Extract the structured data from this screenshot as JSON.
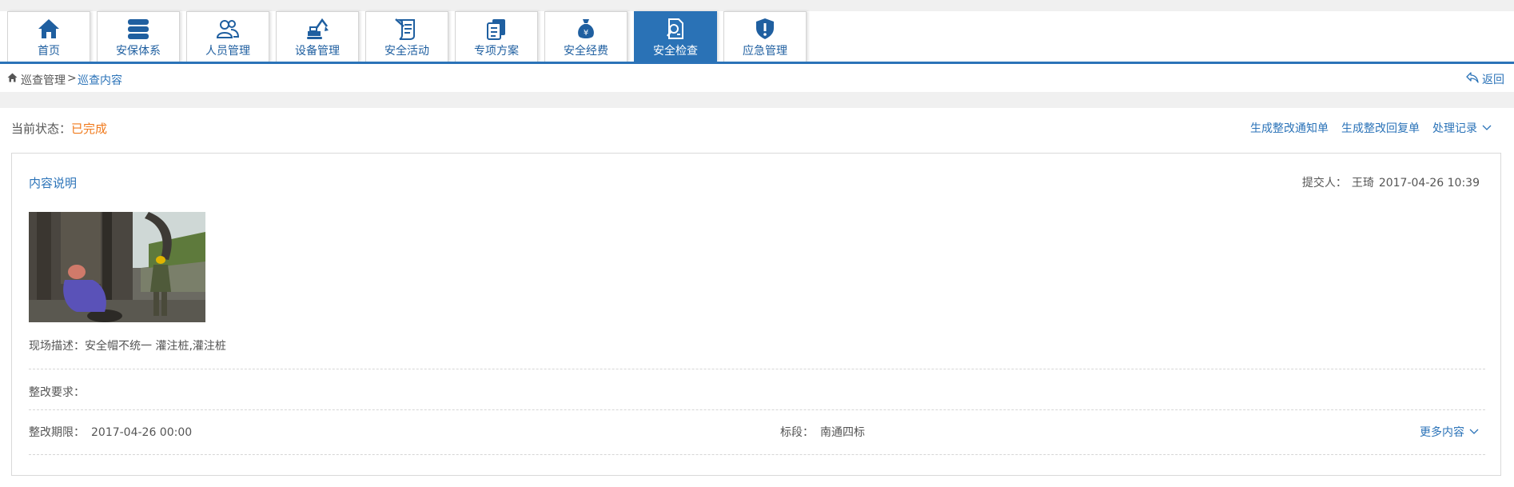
{
  "nav": {
    "tabs": [
      {
        "label": "首页",
        "icon": "home-icon"
      },
      {
        "label": "安保体系",
        "icon": "database-stack-icon"
      },
      {
        "label": "人员管理",
        "icon": "users-icon"
      },
      {
        "label": "设备管理",
        "icon": "excavator-icon"
      },
      {
        "label": "安全活动",
        "icon": "scroll-document-icon"
      },
      {
        "label": "专项方案",
        "icon": "documents-icon"
      },
      {
        "label": "安全经费",
        "icon": "money-bag-icon"
      },
      {
        "label": "安全检查",
        "icon": "document-search-icon"
      },
      {
        "label": "应急管理",
        "icon": "shield-alert-icon"
      }
    ],
    "active_index": 7,
    "accent_color": "#2a72b6"
  },
  "breadcrumb": {
    "root": "巡查管理",
    "separator": ">",
    "current": "巡查内容",
    "back_label": "返回"
  },
  "status": {
    "label": "当前状态：",
    "value": "已完成",
    "value_color": "#f07a1c"
  },
  "actions": {
    "notice": "生成整改通知单",
    "reply": "生成整改回复单",
    "records": "处理记录"
  },
  "card": {
    "title": "内容说明",
    "submitter_label": "提交人：",
    "submitter_name": "王琦",
    "submit_time": "2017-04-26 10:39",
    "photo_alt": "site-photo",
    "description_label": "现场描述：",
    "description_value": "安全帽不统一 灌注桩,灌注桩",
    "requirement_label": "整改要求：",
    "requirement_value": "",
    "deadline_label": "整改期限：",
    "deadline_value": "2017-04-26 00:00",
    "section_label": "标段：",
    "section_value": "南通四标",
    "more_label": "更多内容"
  }
}
